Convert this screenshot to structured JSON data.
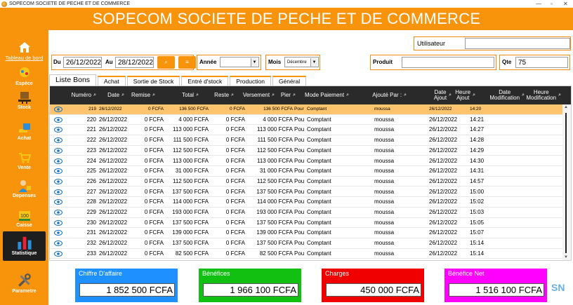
{
  "window": {
    "title": "SOPECOM SOCIETE DE PECHE ET DE COMMERCE",
    "controls": [
      "—",
      "▫",
      "✕"
    ]
  },
  "header": {
    "title": "SOPECOM SOCIETE DE PECHE ET DE COMMERCE"
  },
  "sidebar": {
    "items": [
      {
        "label": "Tableau de bord",
        "icon": "home-icon"
      },
      {
        "label": "Espèce",
        "icon": "fish-icon"
      },
      {
        "label": "Stock",
        "icon": "pallet-icon"
      },
      {
        "label": "Achat",
        "icon": "purchase-icon"
      },
      {
        "label": "Vente",
        "icon": "cart-icon"
      },
      {
        "label": "Depenses",
        "icon": "expense-icon"
      },
      {
        "label": "Caisse",
        "icon": "cash-icon"
      },
      {
        "label": "Statistique",
        "icon": "chart-icon"
      },
      {
        "label": "Parametre",
        "icon": "tools-icon"
      }
    ]
  },
  "filters": {
    "du_label": "Du",
    "du_value": "26/12/2022",
    "au_label": "Au",
    "au_value": "28/12/2022",
    "search_icon": "⌕",
    "list_icon": "≡",
    "annee_label": "Année",
    "annee_value": "",
    "mois_label": "Mois",
    "mois_value": "Décembre",
    "produit_label": "Produit",
    "produit_value": "",
    "qte_label": "Qte",
    "qte_value": "75",
    "utilisateur_label": "Utilisateur",
    "utilisateur_value": ""
  },
  "tabs": [
    "Liste Bons",
    "Achat",
    "Sortie de Stock",
    "Entré d'stock",
    "Production",
    "Général"
  ],
  "table": {
    "columns": [
      {
        "label": "Numéro",
        "l2": ""
      },
      {
        "label": "Date",
        "l2": ""
      },
      {
        "label": "Remise",
        "l2": ""
      },
      {
        "label": "Total",
        "l2": ""
      },
      {
        "label": "Reste",
        "l2": ""
      },
      {
        "label": "Versement",
        "l2": ""
      },
      {
        "label": "Pier",
        "l2": ""
      },
      {
        "label": "Mode Paiement",
        "l2": ""
      },
      {
        "label": "Ajouté Par :",
        "l2": ""
      },
      {
        "label": "Date",
        "l2": "Ajout"
      },
      {
        "label": "Heure",
        "l2": "Ajout"
      },
      {
        "label": "Date",
        "l2": "Modification"
      },
      {
        "label": "Heure",
        "l2": "Modification"
      }
    ],
    "rows": [
      [
        "219",
        "26/12/2022",
        "0 FCFA",
        "136 500 FCFA",
        "0 FCFA",
        "136 500 FCFA",
        "Pour",
        "Comptant",
        "moussa",
        "26/12/2022",
        "14:20"
      ],
      [
        "220",
        "26/12/2022",
        "0 FCFA",
        "4 000 FCFA",
        "0 FCFA",
        "4 000 FCFA",
        "Pou",
        "Comptant",
        "moussa",
        "26/12/2022",
        "14:21"
      ],
      [
        "221",
        "26/12/2022",
        "0 FCFA",
        "113 000 FCFA",
        "0 FCFA",
        "113 000 FCFA",
        "Pou",
        "Comptant",
        "moussa",
        "26/12/2022",
        "14:27"
      ],
      [
        "222",
        "26/12/2022",
        "0 FCFA",
        "111 500 FCFA",
        "0 FCFA",
        "111 500 FCFA",
        "Pou",
        "Comptant",
        "moussa",
        "26/12/2022",
        "14:28"
      ],
      [
        "223",
        "26/12/2022",
        "0 FCFA",
        "112 500 FCFA",
        "0 FCFA",
        "112 500 FCFA",
        "Pou",
        "Comptant",
        "moussa",
        "26/12/2022",
        "14:29"
      ],
      [
        "224",
        "26/12/2022",
        "0 FCFA",
        "113 000 FCFA",
        "0 FCFA",
        "113 000 FCFA",
        "Pou",
        "Comptant",
        "moussa",
        "26/12/2022",
        "14:30"
      ],
      [
        "225",
        "26/12/2022",
        "0 FCFA",
        "31 000 FCFA",
        "0 FCFA",
        "31 000 FCFA",
        "Pou",
        "Comptant",
        "moussa",
        "26/12/2022",
        "14:31"
      ],
      [
        "226",
        "26/12/2022",
        "0 FCFA",
        "112 500 FCFA",
        "0 FCFA",
        "112 500 FCFA",
        "Pou",
        "Comptant",
        "moussa",
        "26/12/2022",
        "14:57"
      ],
      [
        "227",
        "26/12/2022",
        "0 FCFA",
        "137 500 FCFA",
        "0 FCFA",
        "137 500 FCFA",
        "Pou",
        "Comptant",
        "moussa",
        "26/12/2022",
        "15:00"
      ],
      [
        "228",
        "26/12/2022",
        "0 FCFA",
        "114 000 FCFA",
        "0 FCFA",
        "114 000 FCFA",
        "Pou",
        "Comptant",
        "moussa",
        "26/12/2022",
        "15:02"
      ],
      [
        "229",
        "26/12/2022",
        "0 FCFA",
        "193 000 FCFA",
        "0 FCFA",
        "193 000 FCFA",
        "Pou",
        "Comptant",
        "moussa",
        "26/12/2022",
        "15:03"
      ],
      [
        "230",
        "26/12/2022",
        "0 FCFA",
        "137 500 FCFA",
        "0 FCFA",
        "137 500 FCFA",
        "Pou",
        "Comptant",
        "moussa",
        "26/12/2022",
        "15:05"
      ],
      [
        "231",
        "26/12/2022",
        "0 FCFA",
        "139 000 FCFA",
        "0 FCFA",
        "139 000 FCFA",
        "Pou",
        "Comptant",
        "moussa",
        "26/12/2022",
        "15:07"
      ],
      [
        "232",
        "26/12/2022",
        "0 FCFA",
        "137 500 FCFA",
        "0 FCFA",
        "137 500 FCFA",
        "Pou",
        "Comptant",
        "moussa",
        "26/12/2022",
        "15:14"
      ],
      [
        "233",
        "26/12/2022",
        "0 FCFA",
        "82 500 FCFA",
        "0 FCFA",
        "82 500 FCFA",
        "Pou",
        "Comptant",
        "moussa",
        "26/12/2022",
        "15:14"
      ]
    ]
  },
  "cards": [
    {
      "title": "Chiffre D'affaire",
      "value": "1 852 500 FCFA",
      "color": "#1e90ff"
    },
    {
      "title": "Bénéfices",
      "value": "1 966 100 FCFA",
      "color": "#12c012"
    },
    {
      "title": "Charges",
      "value": "450 000 FCFA",
      "color": "#f00000"
    },
    {
      "title": "Bénéfice Net",
      "value": "1 516 100 FCFA",
      "color": "#ff00ff"
    }
  ],
  "watermark": "SN",
  "colors": {
    "accent": "#f7940c",
    "selected_row": "#fdc46d",
    "grid_header": "#2a2a2a",
    "eye_icon": "#1673c8"
  }
}
